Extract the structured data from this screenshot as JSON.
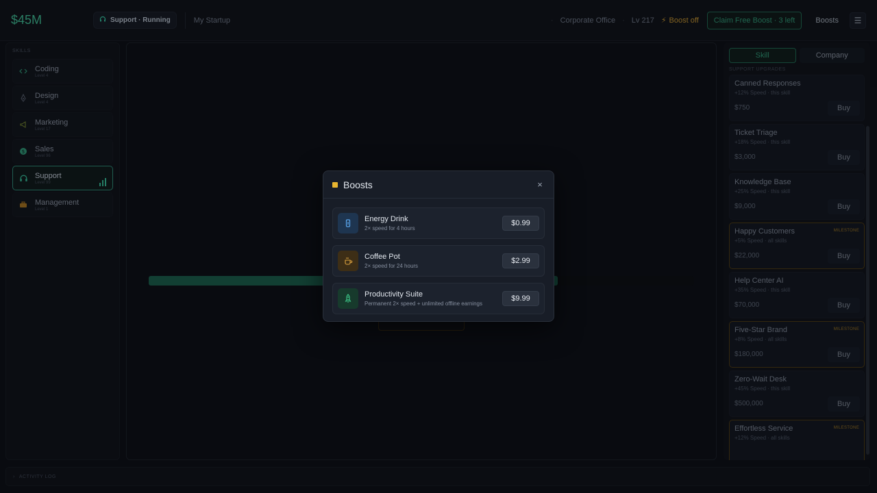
{
  "topbar": {
    "money": "$45M",
    "active_skill": "Support · Running",
    "company_name": "My Startup",
    "office": "Corporate Office",
    "level": "Lv 217",
    "boost_status": "Boost off",
    "claim_button": "Claim Free Boost · 3 left",
    "boosts_link": "Boosts",
    "menu_icon": "sliders-icon"
  },
  "sidebar": {
    "title": "SKILLS",
    "items": [
      {
        "name": "Coding",
        "level": "Level 4",
        "icon": "code-icon",
        "color": "#2f9a77",
        "active": false
      },
      {
        "name": "Design",
        "level": "Level 4",
        "icon": "pen-nib-icon",
        "color": "#5b6472",
        "active": false
      },
      {
        "name": "Marketing",
        "level": "Level 17",
        "icon": "megaphone-icon",
        "color": "#7a8a30",
        "active": false
      },
      {
        "name": "Sales",
        "level": "Level 96",
        "icon": "dollar-coin-icon",
        "color": "#2f9a77",
        "active": false
      },
      {
        "name": "Support",
        "level": "Level 99",
        "icon": "headset-icon",
        "color": "#36bd98",
        "active": true
      },
      {
        "name": "Management",
        "level": "Level 1",
        "icon": "briefcase-icon",
        "color": "#a8741f",
        "active": false
      }
    ]
  },
  "main": {
    "progress_fraction": 0.75
  },
  "right_panel": {
    "tabs": [
      {
        "label": "Skill",
        "active": true
      },
      {
        "label": "Company",
        "active": false
      }
    ],
    "section_title": "SUPPORT UPGRADES",
    "buy_label": "Buy",
    "milestone_label": "MILESTONE",
    "upgrades": [
      {
        "name": "Canned Responses",
        "effect": "+12% Speed",
        "scope": "this skill",
        "price": "$750",
        "milestone": false
      },
      {
        "name": "Ticket Triage",
        "effect": "+18% Speed",
        "scope": "this skill",
        "price": "$3,000",
        "milestone": false
      },
      {
        "name": "Knowledge Base",
        "effect": "+25% Speed",
        "scope": "this skill",
        "price": "$9,000",
        "milestone": false
      },
      {
        "name": "Happy Customers",
        "effect": "+5% Speed",
        "scope": "all skills",
        "price": "$22,000",
        "milestone": true
      },
      {
        "name": "Help Center AI",
        "effect": "+35% Speed",
        "scope": "this skill",
        "price": "$70,000",
        "milestone": false
      },
      {
        "name": "Five-Star Brand",
        "effect": "+8% Speed",
        "scope": "all skills",
        "price": "$180,000",
        "milestone": true
      },
      {
        "name": "Zero-Wait Desk",
        "effect": "+45% Speed",
        "scope": "this skill",
        "price": "$500,000",
        "milestone": false
      },
      {
        "name": "Effortless Service",
        "effect": "+12% Speed",
        "scope": "all skills",
        "price": "",
        "milestone": true
      }
    ]
  },
  "activity_log": {
    "title": "ACTIVITY LOG"
  },
  "modal": {
    "title": "Boosts",
    "close": "×",
    "items": [
      {
        "name": "Energy Drink",
        "desc": "2× speed for 4 hours",
        "price": "$0.99",
        "icon": "energy-can-icon",
        "bg": "#1e3550",
        "fg": "#5aa8f0"
      },
      {
        "name": "Coffee Pot",
        "desc": "2× speed for 24 hours",
        "price": "$2.99",
        "icon": "coffee-icon",
        "bg": "#3d2e16",
        "fg": "#e0a540"
      },
      {
        "name": "Productivity Suite",
        "desc": "Permanent 2× speed + unlimited offline earnings",
        "price": "$9.99",
        "icon": "rocket-icon",
        "bg": "#173a2c",
        "fg": "#3fcf8e"
      }
    ]
  }
}
